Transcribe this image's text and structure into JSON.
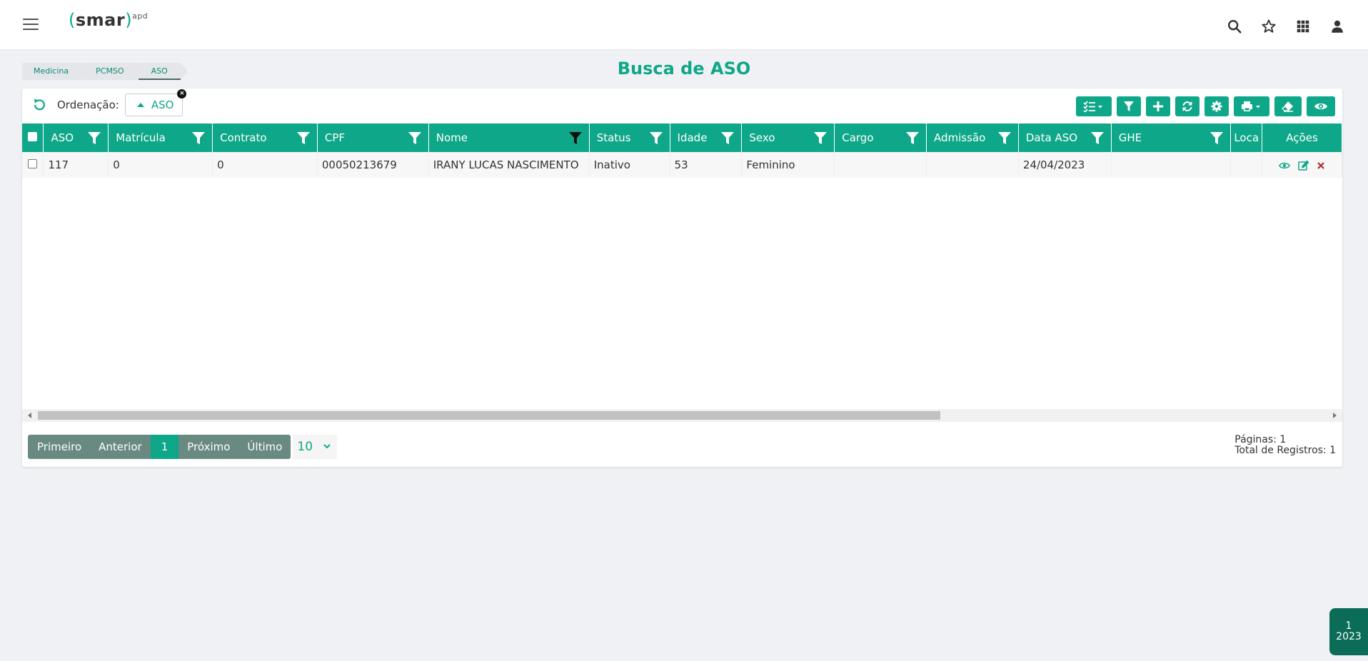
{
  "app": {
    "logo_left": "(",
    "logo_text": "smar",
    "logo_right": ")",
    "logo_sup": "apd"
  },
  "header_icons": [
    "search-icon",
    "star-icon",
    "apps-grid-icon",
    "user-icon"
  ],
  "breadcrumb": [
    "Medicina",
    "PCMSO",
    "ASO"
  ],
  "page_title": "Busca de ASO",
  "sort": {
    "label": "Ordenação:",
    "chip": "ASO"
  },
  "toolbar_buttons": [
    "column-select",
    "filter",
    "add",
    "refresh",
    "settings",
    "print",
    "eraser",
    "view"
  ],
  "colors": {
    "accent": "#0fa789",
    "pagination": "#698a82",
    "badge": "#0b6d58",
    "delete": "#b22a2a"
  },
  "table": {
    "columns": [
      "ASO",
      "Matrícula",
      "Contrato",
      "CPF",
      "Nome",
      "Status",
      "Idade",
      "Sexo",
      "Cargo",
      "Admissão",
      "Data ASO",
      "GHE",
      "Loca",
      "Ações"
    ],
    "rows": [
      {
        "aso": "117",
        "matricula": "0",
        "contrato": "0",
        "cpf": "00050213679",
        "nome": "IRANY LUCAS NASCIMENTO",
        "status": "Inativo",
        "idade": "53",
        "sexo": "Feminino",
        "cargo": "",
        "admissao": "",
        "data_aso": "24/04/2023",
        "ghe": "",
        "local": ""
      }
    ]
  },
  "pagination": {
    "first": "Primeiro",
    "prev": "Anterior",
    "current": "1",
    "next": "Próximo",
    "last": "Último",
    "page_size": "10",
    "pages_info": "Páginas: 1",
    "total_info": "Total de Registros: 1"
  },
  "badge": {
    "line1": "1",
    "line2": "2023"
  }
}
